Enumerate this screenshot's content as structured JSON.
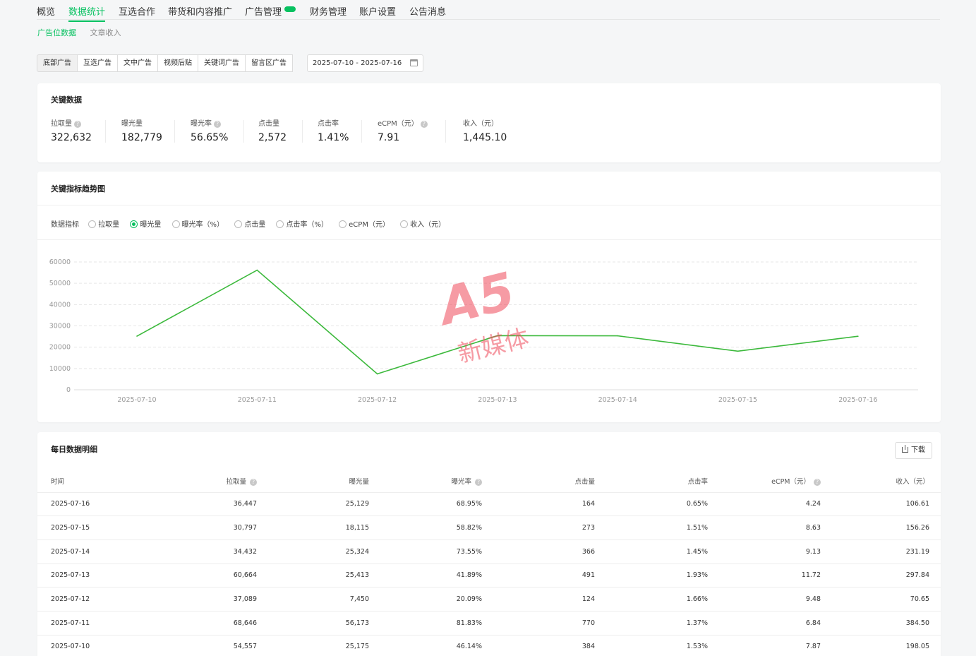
{
  "nav": {
    "items": [
      "概览",
      "数据统计",
      "互选合作",
      "带货和内容推广",
      "广告管理",
      "财务管理",
      "账户设置",
      "公告消息"
    ],
    "active_index": 1
  },
  "subnav": {
    "items": [
      "广告位数据",
      "文章收入"
    ],
    "active_index": 0
  },
  "filters": {
    "ad_types": [
      "底部广告",
      "互选广告",
      "文中广告",
      "视频后贴",
      "关键词广告",
      "留言区广告"
    ],
    "date_range": "2025-07-10 - 2025-07-16"
  },
  "key_data": {
    "title": "关键数据",
    "metrics": [
      {
        "label": "拉取量",
        "value": "322,632",
        "help": true
      },
      {
        "label": "曝光量",
        "value": "182,779",
        "help": false
      },
      {
        "label": "曝光率",
        "value": "56.65%",
        "help": true
      },
      {
        "label": "点击量",
        "value": "2,572",
        "help": false
      },
      {
        "label": "点击率",
        "value": "1.41%",
        "help": false
      },
      {
        "label": "eCPM（元）",
        "value": "7.91",
        "help": true
      },
      {
        "label": "收入（元）",
        "value": "1,445.10",
        "help": false
      }
    ]
  },
  "trend": {
    "title": "关键指标趋势图",
    "selector_label": "数据指标",
    "options": [
      "拉取量",
      "曝光量",
      "曝光率（%）",
      "点击量",
      "点击率（%）",
      "eCPM（元）",
      "收入（元）"
    ],
    "selected_index": 1
  },
  "chart_data": {
    "type": "line",
    "x": [
      "2025-07-10",
      "2025-07-11",
      "2025-07-12",
      "2025-07-13",
      "2025-07-14",
      "2025-07-15",
      "2025-07-16"
    ],
    "series": [
      {
        "values": [
          25175,
          56173,
          7450,
          25413,
          25324,
          18115,
          25129
        ]
      }
    ],
    "ylim": [
      0,
      60000
    ],
    "yticks": [
      0,
      10000,
      20000,
      30000,
      40000,
      50000,
      60000
    ],
    "grid": true,
    "color": "#3cb93c"
  },
  "daily": {
    "title": "每日数据明细",
    "download_label": "下载",
    "columns": [
      "时间",
      "拉取量",
      "曝光量",
      "曝光率",
      "点击量",
      "点击率",
      "eCPM（元）",
      "收入（元）"
    ],
    "rows": [
      [
        "2025-07-16",
        "36,447",
        "25,129",
        "68.95%",
        "164",
        "0.65%",
        "4.24",
        "106.61"
      ],
      [
        "2025-07-15",
        "30,797",
        "18,115",
        "58.82%",
        "273",
        "1.51%",
        "8.63",
        "156.26"
      ],
      [
        "2025-07-14",
        "34,432",
        "25,324",
        "73.55%",
        "366",
        "1.45%",
        "9.13",
        "231.19"
      ],
      [
        "2025-07-13",
        "60,664",
        "25,413",
        "41.89%",
        "491",
        "1.93%",
        "11.72",
        "297.84"
      ],
      [
        "2025-07-12",
        "37,089",
        "7,450",
        "20.09%",
        "124",
        "1.66%",
        "9.48",
        "70.65"
      ],
      [
        "2025-07-11",
        "68,646",
        "56,173",
        "81.83%",
        "770",
        "1.37%",
        "6.84",
        "384.50"
      ],
      [
        "2025-07-10",
        "54,557",
        "25,175",
        "46.14%",
        "384",
        "1.53%",
        "7.87",
        "198.05"
      ]
    ]
  },
  "watermark": {
    "logo": "A5",
    "text": "新媒体"
  }
}
